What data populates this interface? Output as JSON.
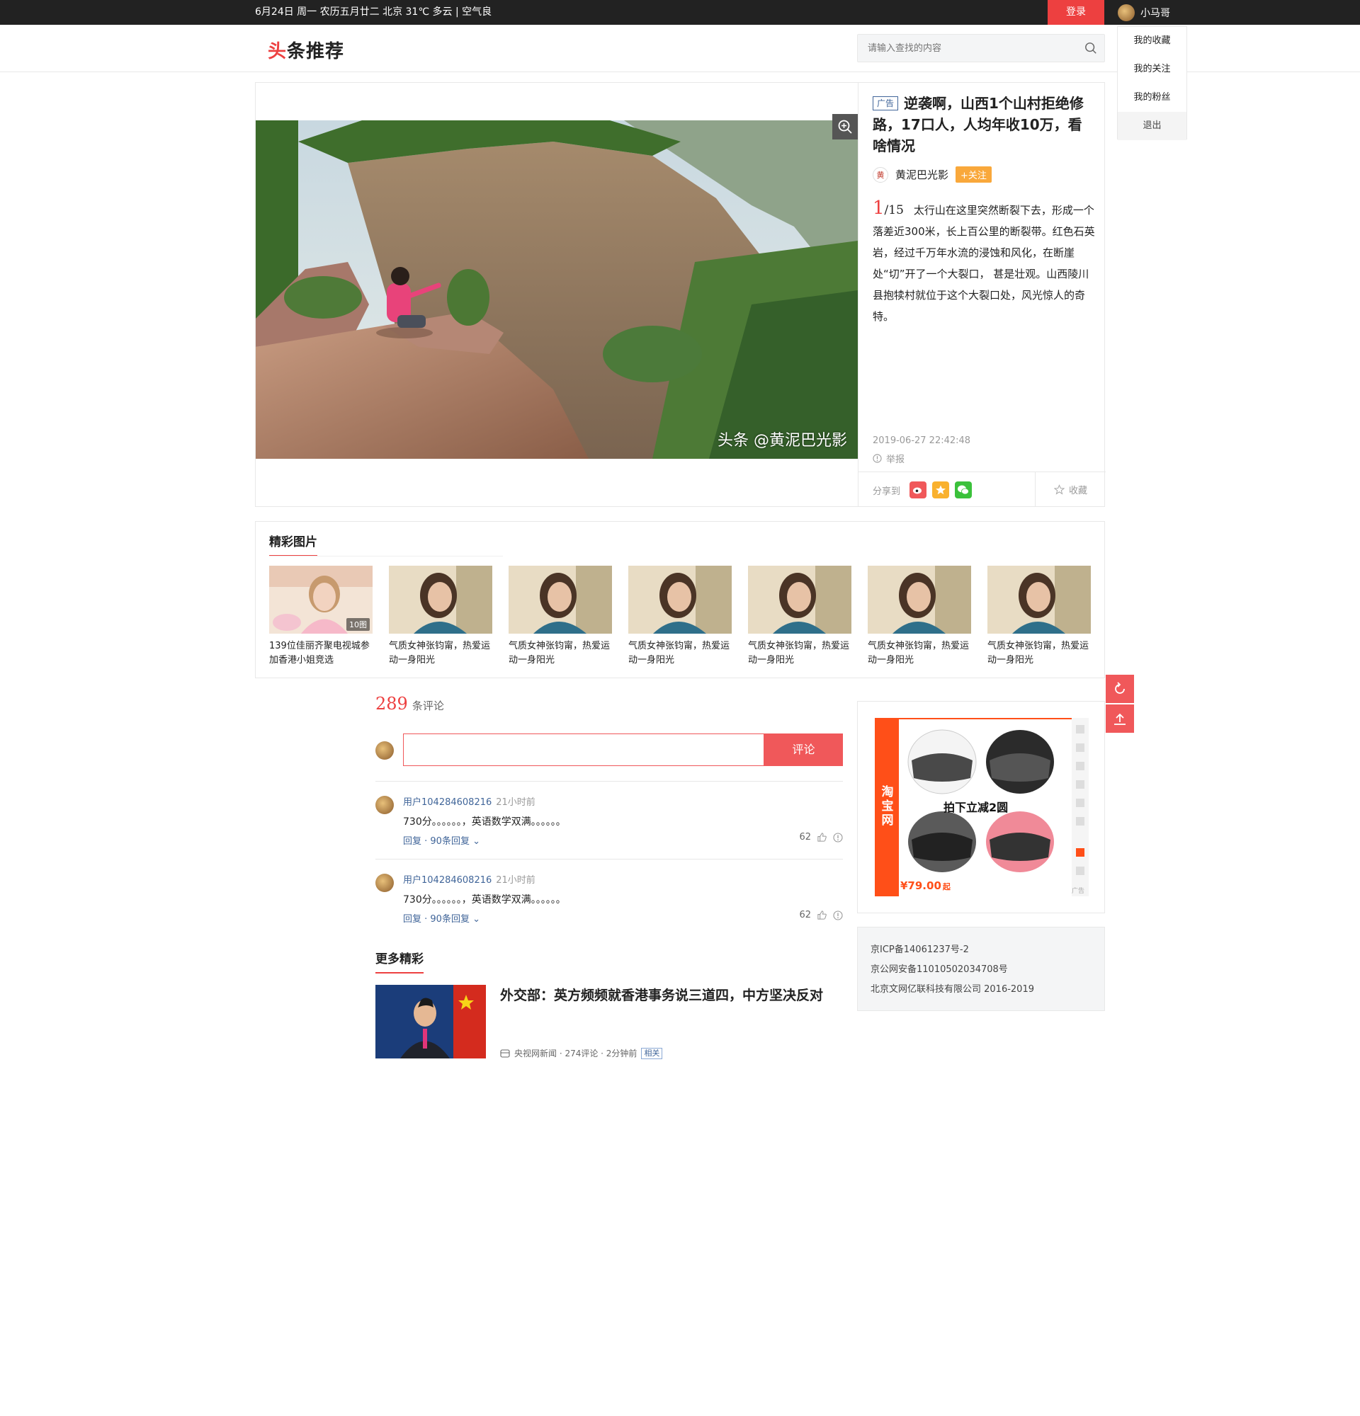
{
  "topbar": {
    "date_weather": "6月24日 周一 农历五月廿二 北京 31℃ 多云 | 空气良",
    "login_label": "登录",
    "username": "小马哥"
  },
  "user_menu": {
    "items": [
      "我的收藏",
      "我的关注",
      "我的粉丝"
    ],
    "logout": "退出"
  },
  "header": {
    "logo_first": "头",
    "logo_rest": "条推荐",
    "search_placeholder": "请输入查找的内容"
  },
  "gallery": {
    "watermark": "头条 @黄泥巴光影",
    "ad_tag": "广告",
    "title": "逆袭啊，山西1个山村拒绝修路，17口人，人均年收10万，看啥情况",
    "author": "黄泥巴光影",
    "follow_label": "+关注",
    "current_index": "1",
    "total": "/15",
    "description": "太行山在这里突然断裂下去，形成一个落差近300米，长上百公里的断裂带。红色石英岩，经过千万年水流的浸蚀和风化，在断崖处“切”开了一个大裂口， 甚是壮观。山西陵川县抱犊村就位于这个大裂口处，风光惊人的奇特。",
    "timestamp": "2019-06-27 22:42:48",
    "report_label": "举报",
    "share_label": "分享到",
    "favorite_label": "收藏",
    "colors": {
      "accent": "#ed4040",
      "follow": "#f9a83b",
      "link": "#406599"
    }
  },
  "featured": {
    "title": "精彩图片",
    "items": [
      {
        "caption": "139位佳丽齐聚电视城参加香港小姐竞选",
        "count": "10图"
      },
      {
        "caption": "气质女神张钧甯，热爱运动一身阳光"
      },
      {
        "caption": "气质女神张钧甯，热爱运动一身阳光"
      },
      {
        "caption": "气质女神张钧甯，热爱运动一身阳光"
      },
      {
        "caption": "气质女神张钧甯，热爱运动一身阳光"
      },
      {
        "caption": "气质女神张钧甯，热爱运动一身阳光"
      },
      {
        "caption": "气质女神张钧甯，热爱运动一身阳光"
      }
    ]
  },
  "comments": {
    "count": "289",
    "count_suffix": "条评论",
    "submit_label": "评论",
    "items": [
      {
        "user": "用户104284608216",
        "time": "21小时前",
        "text": "730分。。。。。。，英语数学双满。。。。。。",
        "actions": "回复 · 90条回复 ⌄",
        "likes": "62"
      },
      {
        "user": "用户104284608216",
        "time": "21小时前",
        "text": "730分。。。。。。，英语数学双满。。。。。。",
        "actions": "回复 · 90条回复 ⌄",
        "likes": "62"
      }
    ]
  },
  "more": {
    "title": "更多精彩",
    "news": {
      "title": "外交部：英方频频就香港事务说三道四，中方坚决反对",
      "meta": "央视网新闻 · 274评论 · 2分钟前",
      "tag": "相关"
    }
  },
  "ad": {
    "brand": "淘宝网",
    "product_text": "拍下立减2圆",
    "price": "¥79.00",
    "price_suffix": "起",
    "ad_mark": "广告"
  },
  "footer": {
    "lines": [
      "京ICP备14061237号-2",
      "京公网安备11010502034708号",
      "北京文网亿联科技有限公司 2016-2019"
    ]
  }
}
